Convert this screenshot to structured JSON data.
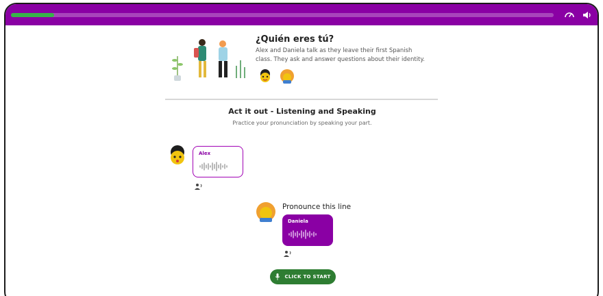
{
  "header": {
    "progress_fraction": 0.08,
    "accent_color": "#8a00a4",
    "progress_color": "#38b24a",
    "icons": [
      "speed-icon",
      "volume-icon"
    ]
  },
  "lesson": {
    "title": "¿Quién eres tú?",
    "description": "Alex and Daniela talk as they leave their first Spanish class. They ask and answer questions about their identity."
  },
  "activity": {
    "title": "Act it out - Listening and Speaking",
    "subtitle": "Practice your pronunciation by speaking your part."
  },
  "dialogue": [
    {
      "speaker": "Alex"
    },
    {
      "speaker": "Daniela",
      "prompt": "Pronounce this line"
    }
  ],
  "start_button": {
    "label": "CLICK TO START",
    "color": "#2e7d32"
  }
}
